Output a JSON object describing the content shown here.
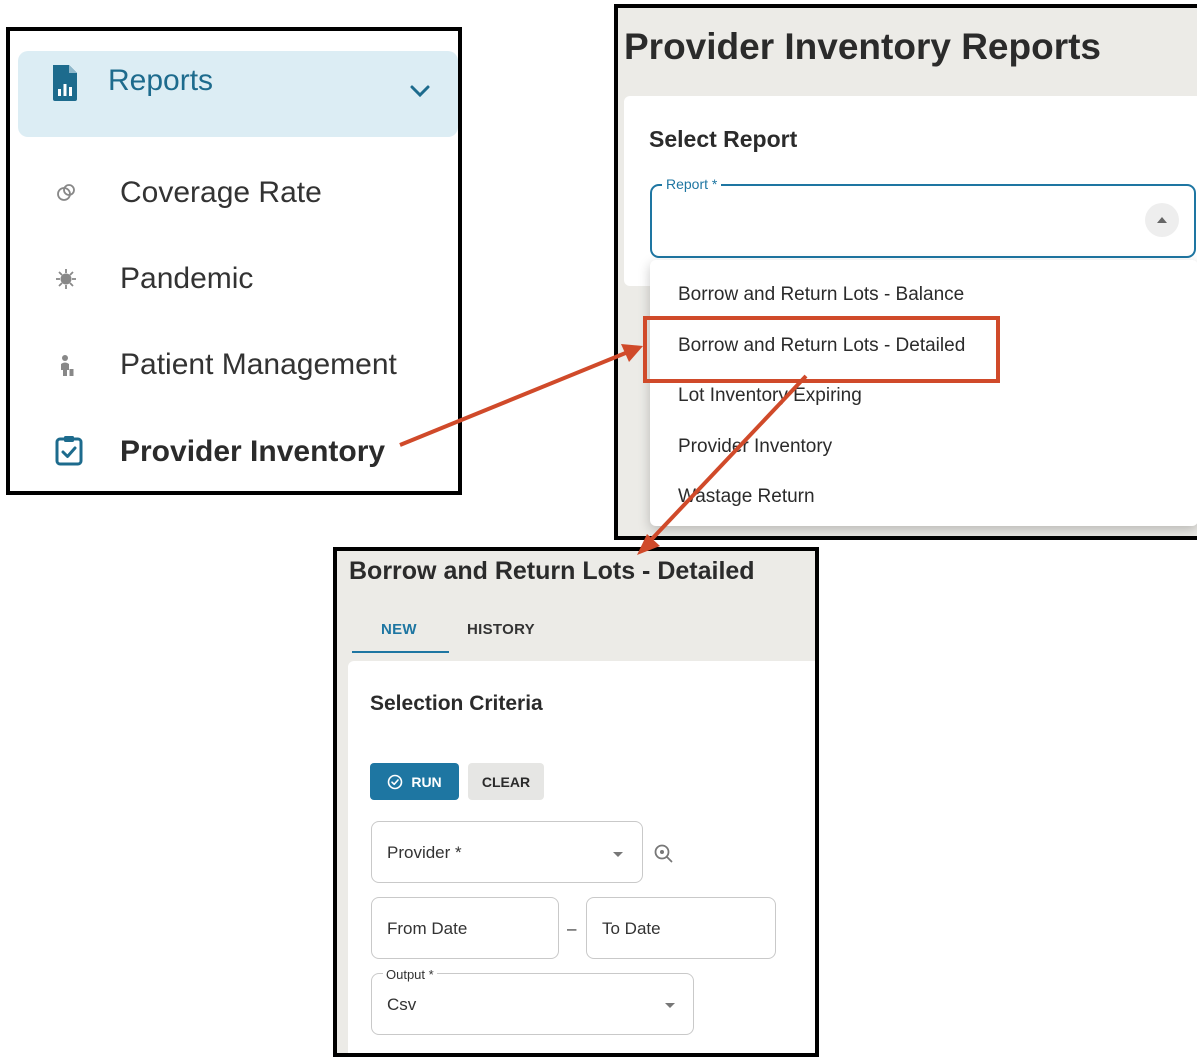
{
  "nav": {
    "section_label": "Reports",
    "items": [
      {
        "label": "Coverage Rate",
        "icon": "coverage-icon"
      },
      {
        "label": "Pandemic",
        "icon": "virus-icon"
      },
      {
        "label": "Patient Management",
        "icon": "patient-icon"
      },
      {
        "label": "Provider Inventory",
        "icon": "clipboard-check-icon",
        "active": true
      }
    ]
  },
  "reports": {
    "title": "Provider Inventory Reports",
    "select_title": "Select Report",
    "field_label": "Report *",
    "options": [
      "Borrow and Return Lots - Balance",
      "Borrow and Return Lots - Detailed",
      "Lot Inventory Expiring",
      "Provider Inventory",
      "Wastage Return"
    ],
    "highlighted_option": "Borrow and Return Lots - Detailed"
  },
  "detail": {
    "title": "Borrow and Return Lots - Detailed",
    "tabs": [
      "NEW",
      "HISTORY"
    ],
    "section_title": "Selection Criteria",
    "run_label": "RUN",
    "clear_label": "CLEAR",
    "provider_placeholder": "Provider *",
    "from_date_placeholder": "From Date",
    "date_separator": "–",
    "to_date_placeholder": "To Date",
    "output_label": "Output *",
    "output_value": "Csv"
  },
  "colors": {
    "accent": "#1e76a2",
    "nav_active_bg": "#dcedf4",
    "annotation": "#d04a2a",
    "page_bg": "#ecebe7"
  }
}
